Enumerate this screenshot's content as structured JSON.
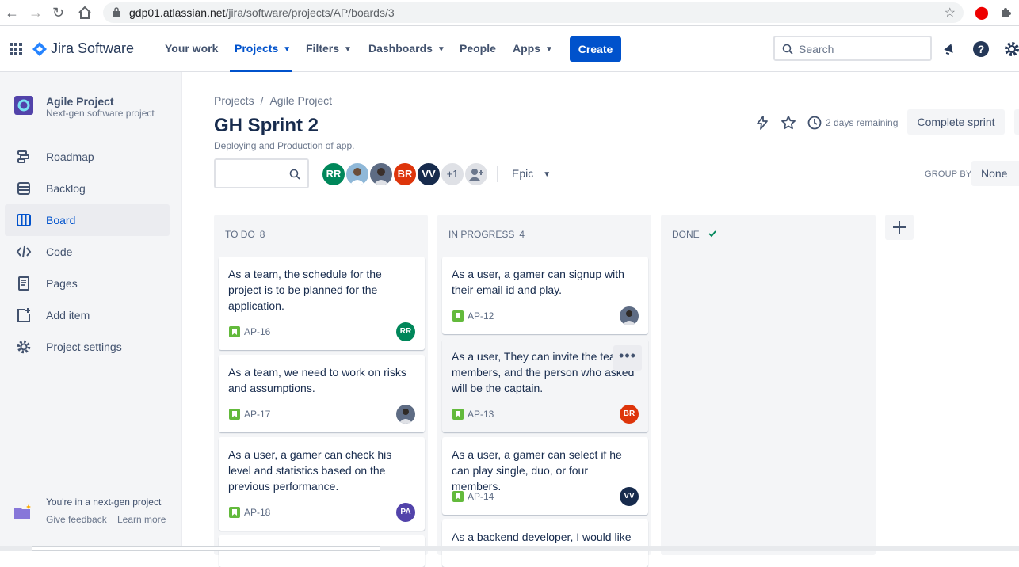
{
  "browser": {
    "url_host": "gdp01.atlassian.net",
    "url_path": "/jira/software/projects/AP/boards/3"
  },
  "topnav": {
    "product": "Jira Software",
    "your_work": "Your work",
    "projects": "Projects",
    "filters": "Filters",
    "dashboards": "Dashboards",
    "people": "People",
    "apps": "Apps",
    "create": "Create",
    "search_placeholder": "Search"
  },
  "sidebar": {
    "project_name": "Agile Project",
    "project_type": "Next-gen software project",
    "items": [
      {
        "label": "Roadmap",
        "icon": "roadmap-icon"
      },
      {
        "label": "Backlog",
        "icon": "backlog-icon"
      },
      {
        "label": "Board",
        "icon": "board-icon"
      },
      {
        "label": "Code",
        "icon": "code-icon"
      },
      {
        "label": "Pages",
        "icon": "pages-icon"
      },
      {
        "label": "Add item",
        "icon": "add-item-icon"
      },
      {
        "label": "Project settings",
        "icon": "gear-icon"
      }
    ],
    "footer_text": "You're in a next-gen project",
    "give_feedback": "Give feedback",
    "learn_more": "Learn more"
  },
  "header": {
    "breadcrumb_projects": "Projects",
    "breadcrumb_sep": "/",
    "breadcrumb_project": "Agile Project",
    "title": "GH Sprint 2",
    "description": "Deploying and Production of app.",
    "remaining": "2 days remaining",
    "complete_sprint": "Complete sprint"
  },
  "filters": {
    "avatars": [
      {
        "initials": "RR",
        "color": "#00875a"
      },
      {
        "initials": "",
        "color": "#8fb8d8"
      },
      {
        "initials": "",
        "color": "#5e6c84"
      },
      {
        "initials": "BR",
        "color": "#de350b"
      },
      {
        "initials": "VV",
        "color": "#172b4d"
      },
      {
        "initials": "+1",
        "color": "#dfe1e6"
      }
    ],
    "epic": "Epic",
    "group_by": "GROUP BY",
    "group_value": "None"
  },
  "columns": [
    {
      "name": "TO DO",
      "count": "8",
      "cards": [
        {
          "text": "As a team, the schedule for the project is to be planned for the application.",
          "key": "AP-16",
          "assignee": "RR",
          "color": "#00875a"
        },
        {
          "text": "As a team, we need to work on risks and assumptions.",
          "key": "AP-17",
          "assignee": "",
          "color": "#5e6c84"
        },
        {
          "text": "As a user, a gamer can check his level and statistics based on the previous performance.",
          "key": "AP-18",
          "assignee": "PA",
          "color": "#5243aa"
        }
      ]
    },
    {
      "name": "IN PROGRESS",
      "count": "4",
      "cards": [
        {
          "text": "As a user, a gamer can signup with their email id and play.",
          "key": "AP-12",
          "assignee": "",
          "color": "#5e6c84"
        },
        {
          "text": "As a user, They can invite the team members, and the person who asked will be the captain.",
          "key": "AP-13",
          "assignee": "BR",
          "color": "#de350b"
        },
        {
          "text": "As a user, a gamer can select if he can play single, duo, or four members.",
          "key": "AP-14",
          "assignee": "VV",
          "color": "#172b4d"
        },
        {
          "text": "As a backend developer, I would like",
          "key": "",
          "assignee": "",
          "color": ""
        }
      ]
    },
    {
      "name": "DONE",
      "count": "",
      "cards": []
    }
  ]
}
